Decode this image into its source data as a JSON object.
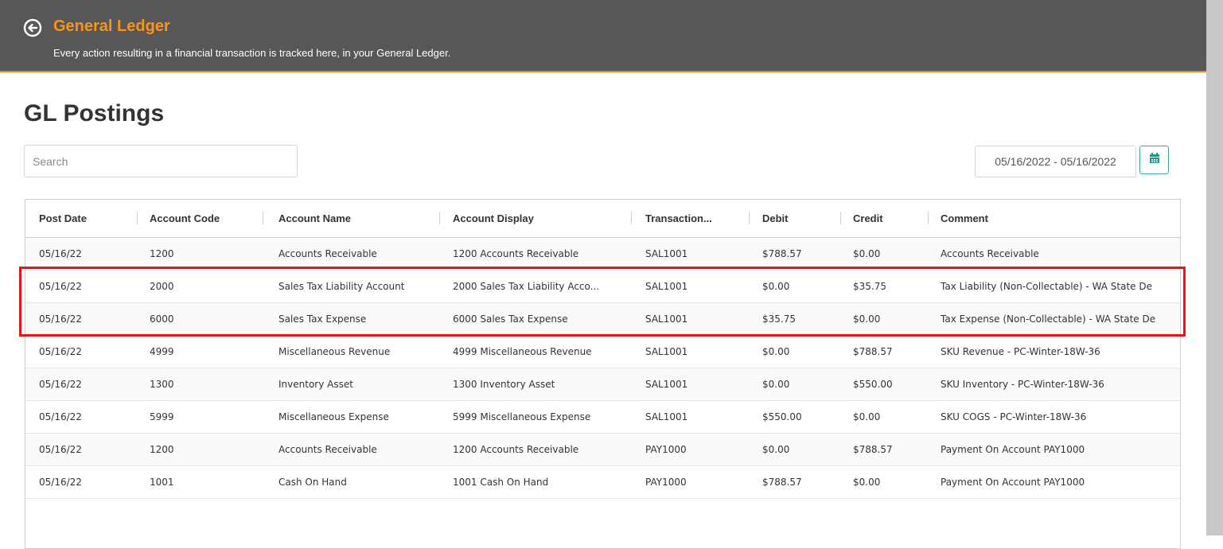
{
  "header": {
    "title": "General Ledger",
    "subtitle": "Every action resulting in a financial transaction is tracked here, in your General Ledger."
  },
  "page": {
    "title": "GL Postings"
  },
  "search": {
    "placeholder": "Search",
    "value": ""
  },
  "date_range": {
    "value": "05/16/2022 - 05/16/2022"
  },
  "icons": {
    "back": "back-arrow-circle-icon",
    "calendar": "calendar-icon"
  },
  "colors": {
    "accent": "#f7941d",
    "header_bg": "#575757",
    "highlight": "#e8141b",
    "calendar_border": "#3aa5a0"
  },
  "table": {
    "columns": [
      "Post Date",
      "Account Code",
      "Account Name",
      "Account Display",
      "Transaction...",
      "Debit",
      "Credit",
      "Comment"
    ],
    "rows": [
      [
        "05/16/22",
        "1200",
        "Accounts Receivable",
        "1200 Accounts Receivable",
        "SAL1001",
        "$788.57",
        "$0.00",
        "Accounts Receivable"
      ],
      [
        "05/16/22",
        "2000",
        "Sales Tax Liability Account",
        "2000 Sales Tax Liability Acco...",
        "SAL1001",
        "$0.00",
        "$35.75",
        "Tax Liability (Non-Collectable) - WA State De"
      ],
      [
        "05/16/22",
        "6000",
        "Sales Tax Expense",
        "6000 Sales Tax Expense",
        "SAL1001",
        "$35.75",
        "$0.00",
        "Tax Expense (Non-Collectable) - WA State De"
      ],
      [
        "05/16/22",
        "4999",
        "Miscellaneous Revenue",
        "4999 Miscellaneous Revenue",
        "SAL1001",
        "$0.00",
        "$788.57",
        "SKU Revenue - PC-Winter-18W-36"
      ],
      [
        "05/16/22",
        "1300",
        "Inventory Asset",
        "1300 Inventory Asset",
        "SAL1001",
        "$0.00",
        "$550.00",
        "SKU Inventory - PC-Winter-18W-36"
      ],
      [
        "05/16/22",
        "5999",
        "Miscellaneous Expense",
        "5999 Miscellaneous Expense",
        "SAL1001",
        "$550.00",
        "$0.00",
        "SKU COGS - PC-Winter-18W-36"
      ],
      [
        "05/16/22",
        "1200",
        "Accounts Receivable",
        "1200 Accounts Receivable",
        "PAY1000",
        "$0.00",
        "$788.57",
        "Payment On Account PAY1000"
      ],
      [
        "05/16/22",
        "1001",
        "Cash On Hand",
        "1001 Cash On Hand",
        "PAY1000",
        "$788.57",
        "$0.00",
        "Payment On Account PAY1000"
      ]
    ]
  }
}
